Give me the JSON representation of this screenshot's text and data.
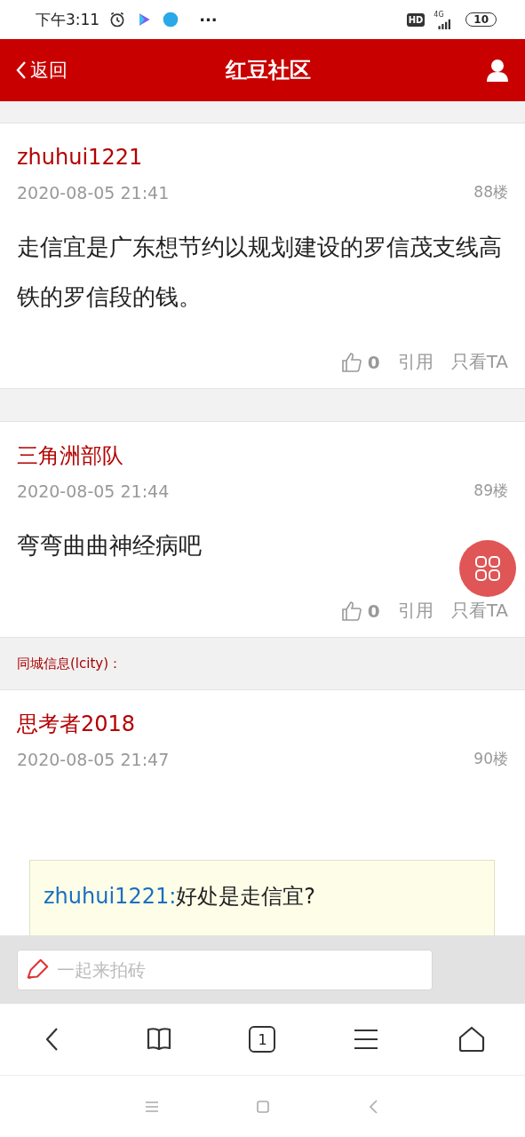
{
  "status_bar": {
    "time": "下午3:11",
    "more": "···",
    "hd": "HD",
    "network": "4G",
    "battery": "10"
  },
  "header": {
    "back": "返回",
    "title": "红豆社区"
  },
  "posts": [
    {
      "author": "zhuhui1221",
      "time": "2020-08-05 21:41",
      "floor": "88楼",
      "body": "走信宜是广东想节约以规划建设的罗信茂支线高铁的罗信段的钱。",
      "likes": "0",
      "quote_action": "引用",
      "only_action": "只看TA"
    },
    {
      "author": "三角洲部队",
      "time": "2020-08-05 21:44",
      "floor": "89楼",
      "body": "弯弯曲曲神经病吧",
      "likes": "0",
      "quote_action": "引用",
      "only_action": "只看TA",
      "notice": "同城信息(lcity)："
    },
    {
      "author": "思考者2018",
      "time": "2020-08-05 21:47",
      "floor": "90楼",
      "quote": {
        "user": "zhuhui1221:",
        "text": "好处是走信宜?"
      }
    }
  ],
  "composer": {
    "placeholder": "一起来拍砖"
  },
  "toolbar": {
    "tabs_count": "1"
  }
}
